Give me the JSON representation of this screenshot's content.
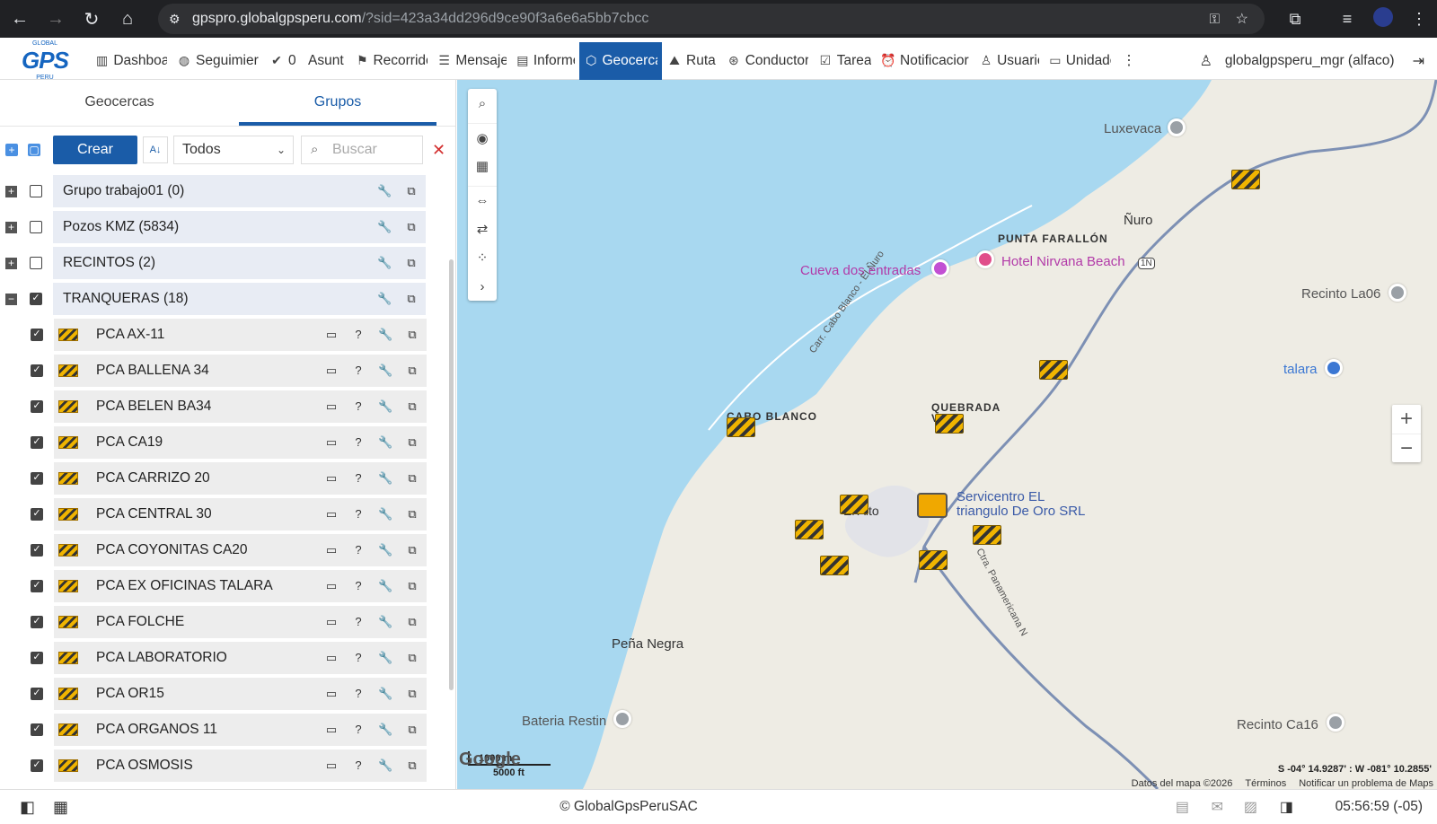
{
  "browser": {
    "url_host": "gpspro.globalgpsperu.com",
    "url_rest": "/?sid=423a34dd296d9ce90f3a6e6a5bb7cbcc"
  },
  "app": {
    "logo_text": "GPS",
    "logo_top": "GLOBAL",
    "logo_bottom": "PERU",
    "menu": [
      {
        "label": "Dashboa",
        "icon": "bar-chart-icon"
      },
      {
        "label": "Seguimier",
        "icon": "globe-icon"
      },
      {
        "label": "0",
        "icon": "check-circle-icon"
      },
      {
        "label": "Asunt",
        "icon": ""
      },
      {
        "label": "Recorridc",
        "icon": "flag-icon"
      },
      {
        "label": "Mensaje",
        "icon": "document-icon"
      },
      {
        "label": "Informe",
        "icon": "report-icon"
      },
      {
        "label": "Geocerca",
        "icon": "geofence-icon"
      },
      {
        "label": "Ruta",
        "icon": "route-icon"
      },
      {
        "label": "Conductor",
        "icon": "steering-icon"
      },
      {
        "label": "Tarea",
        "icon": "task-icon"
      },
      {
        "label": "Notificacior",
        "icon": "alarm-icon"
      },
      {
        "label": "Usuaric",
        "icon": "user-icon"
      },
      {
        "label": "Unidade",
        "icon": "bus-icon"
      }
    ],
    "user": "globalgpsperu_mgr (alfaco)"
  },
  "sidebar": {
    "tabs": [
      "Geocercas",
      "Grupos"
    ],
    "create_label": "Crear",
    "sort_label": "A↓",
    "filter_value": "Todos",
    "search_placeholder": "Buscar",
    "groups": [
      {
        "name": "Grupo trabajo01 (0)",
        "expanded": false,
        "checked": false
      },
      {
        "name": "Pozos KMZ (5834)",
        "expanded": false,
        "checked": false
      },
      {
        "name": "RECINTOS (2)",
        "expanded": false,
        "checked": false
      },
      {
        "name": "TRANQUERAS (18)",
        "expanded": true,
        "checked": true
      }
    ],
    "items": [
      "PCA AX-11",
      "PCA BALLENA 34",
      "PCA BELEN BA34",
      "PCA CA19",
      "PCA CARRIZO 20",
      "PCA CENTRAL 30",
      "PCA COYONITAS CA20",
      "PCA EX OFICINAS TALARA",
      "PCA FOLCHE",
      "PCA LABORATORIO",
      "PCA OR15",
      "PCA ORGANOS 11",
      "PCA OSMOSIS"
    ],
    "item_unit_mark": "?"
  },
  "map": {
    "labels": {
      "luxevaca": "Luxevaca",
      "nuro": "Ñuro",
      "punta": "PUNTA FARALLÓN",
      "cueva": "Cueva dos entradas",
      "hotel": "Hotel Nirvana Beach",
      "recinto06": "Recinto La06",
      "talara": "talara",
      "cabo": "CABO BLANCO",
      "quebrada": "QUEBRADA",
      "quebrada2": "V",
      "carr": "Carr. Cabo Blanco - El Ñuro",
      "servicentro": "Servicentro EL",
      "servicentro2": "triangulo De Oro SRL",
      "elalto": "El Alto",
      "panamericana": "Ctra. Panamericana N",
      "penanegra": "Peña Negra",
      "bateria": "Bateria Restin",
      "recinto16": "Recinto Ca16",
      "highway": "1N"
    },
    "scale_m": "1000 m",
    "scale_ft": "5000 ft",
    "google": "Google",
    "coords": "S -04° 14.9287' : W -081° 10.2855'",
    "attribution": [
      "Datos del mapa ©2026",
      "Términos",
      "Notificar un problema de Maps"
    ]
  },
  "footer": {
    "copyright": "© GlobalGpsPeruSAC",
    "clock": "05:56:59 (-05)"
  }
}
